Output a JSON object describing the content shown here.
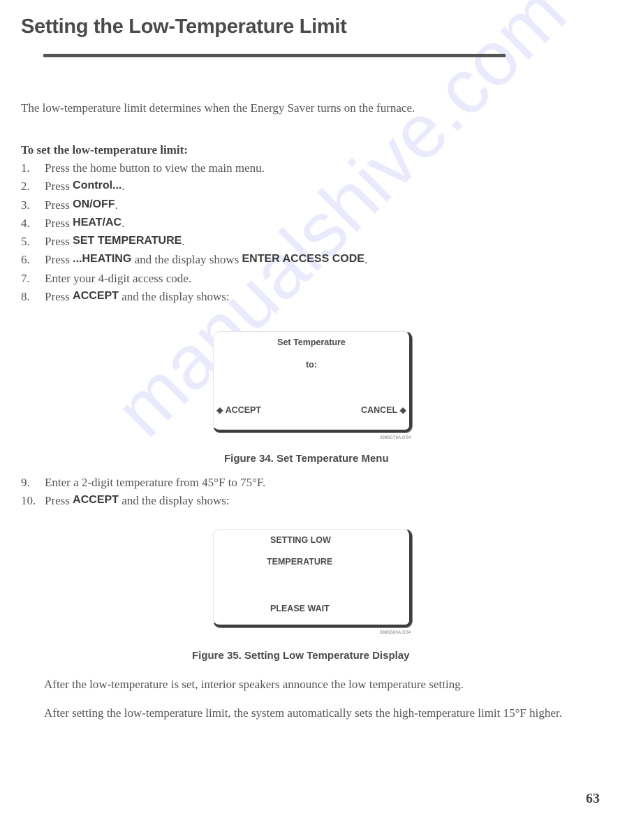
{
  "page": {
    "title": "Setting the Low-Temperature Limit",
    "intro": "The low-temperature limit determines when the Energy Saver turns on the furnace.",
    "procedure_heading": "To set the low-temperature limit:",
    "steps": [
      {
        "num": "1.",
        "pre": "Press the home button to view the main menu.",
        "bold": "",
        "post": "",
        "bold2": "",
        "post2": ""
      },
      {
        "num": "2.",
        "pre": "Press ",
        "bold": "Control...",
        "post": ".",
        "bold2": "",
        "post2": ""
      },
      {
        "num": "3.",
        "pre": "Press ",
        "bold": "ON/OFF",
        "post": ".",
        "bold2": "",
        "post2": ""
      },
      {
        "num": "4.",
        "pre": "Press ",
        "bold": "HEAT/AC",
        "post": ".",
        "bold2": "",
        "post2": ""
      },
      {
        "num": "5.",
        "pre": "Press ",
        "bold": "SET TEMPERATURE",
        "post": ".",
        "bold2": "",
        "post2": ""
      },
      {
        "num": "6.",
        "pre": "Press ",
        "bold": "...HEATING",
        "post": " and the display shows ",
        "bold2": "ENTER ACCESS CODE",
        "post2": "."
      },
      {
        "num": "7.",
        "pre": "Enter your 4-digit access code.",
        "bold": "",
        "post": "",
        "bold2": "",
        "post2": ""
      },
      {
        "num": "8.",
        "pre": "Press ",
        "bold": "ACCEPT",
        "post": " and the display shows:",
        "bold2": "",
        "post2": ""
      }
    ],
    "steps_after": [
      {
        "num": "9.",
        "pre": "Enter a 2-digit temperature from 45°F to 75°F.",
        "bold": "",
        "post": ""
      },
      {
        "num": "10.",
        "pre": "Press ",
        "bold": "ACCEPT",
        "post": " and the display shows:"
      }
    ],
    "figure34": {
      "line1": "Set Temperature",
      "line2": "to:",
      "left_softkey": "ACCEPT",
      "right_softkey": "CANCEL",
      "softkey_marker": "◆",
      "code": "3888G78A.DS4",
      "caption": "Figure 34. Set Temperature Menu"
    },
    "figure35": {
      "line1": "SETTING LOW",
      "line2": "TEMPERATURE",
      "line3": "PLEASE WAIT",
      "code": "3888G80A.DS4",
      "caption": "Figure 35. Setting Low Temperature Display"
    },
    "para1": "After the low-temperature is set, interior speakers announce the low temperature setting.",
    "para2": "After setting the low-temperature limit, the system automatically sets the high-temperature limit 15°F higher.",
    "page_number": "63",
    "watermark": "manualshive.com"
  }
}
